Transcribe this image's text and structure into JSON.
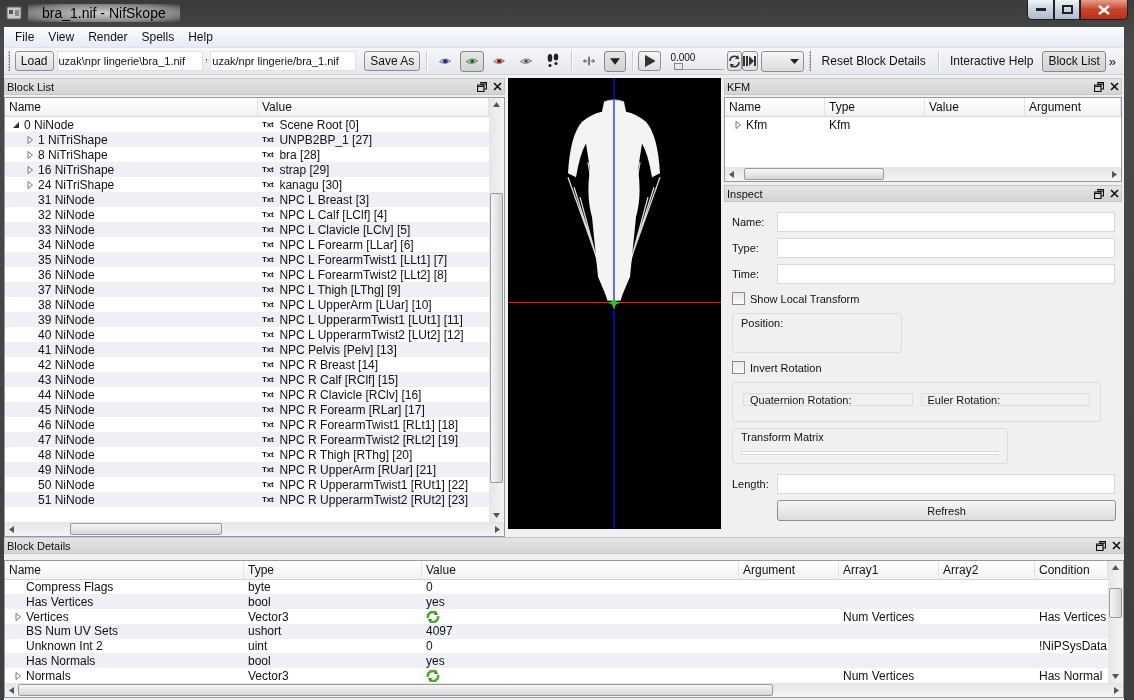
{
  "window": {
    "title": "bra_1.nif - NifSkope"
  },
  "menu": [
    "File",
    "View",
    "Render",
    "Spells",
    "Help"
  ],
  "toolbar": {
    "load_label": "Load",
    "path_in": "uzak\\npr lingerie\\bra_1.nif",
    "path_out": "uzak/npr lingerie/bra_1.nif",
    "save_label": "Save As",
    "view_tools": [
      {
        "kind": "eye",
        "color": "#2b3fc4",
        "selected": false
      },
      {
        "kind": "eye",
        "color": "#3a9f3e",
        "selected": true
      },
      {
        "kind": "eye",
        "color": "#c42020",
        "selected": false
      },
      {
        "kind": "eye",
        "color": "#8c8c8c",
        "selected": false
      },
      {
        "kind": "footprints",
        "selected": false
      },
      {
        "kind": "move",
        "selected": false
      },
      {
        "kind": "dropdown",
        "selected": true
      }
    ],
    "time": {
      "reading": "0.000",
      "level": 0
    },
    "actions": [
      {
        "label": "Reset Block Details",
        "selected": false
      },
      {
        "label": "Interactive Help",
        "selected": false
      },
      {
        "label": "Block List",
        "selected": true
      }
    ],
    "overflow": "»"
  },
  "block_list": {
    "title": "Block List",
    "columns": [
      "Name",
      "Value"
    ],
    "rows": [
      {
        "name": "0 NiNode",
        "tag": "Txt",
        "value": "Scene Root [0]",
        "has_children": true,
        "expanded": true,
        "children": [
          {
            "name": "1 NiTriShape",
            "tag": "Txt",
            "value": "UNPB2BP_1 [27]",
            "has_children": true,
            "expanded": false
          },
          {
            "name": "8 NiTriShape",
            "tag": "Txt",
            "value": "bra [28]",
            "has_children": true,
            "expanded": false
          },
          {
            "name": "16 NiTriShape",
            "tag": "Txt",
            "value": "strap [29]",
            "has_children": true,
            "expanded": false
          },
          {
            "name": "24 NiTriShape",
            "tag": "Txt",
            "value": "kanagu [30]",
            "has_children": true,
            "expanded": false
          },
          {
            "name": "31 NiNode",
            "tag": "Txt",
            "value": "NPC L Breast [3]",
            "has_children": false,
            "expanded": false
          },
          {
            "name": "32 NiNode",
            "tag": "Txt",
            "value": "NPC L Calf [LClf] [4]",
            "has_children": false,
            "expanded": false
          },
          {
            "name": "33 NiNode",
            "tag": "Txt",
            "value": "NPC L Clavicle [LClv] [5]",
            "has_children": false,
            "expanded": false
          },
          {
            "name": "34 NiNode",
            "tag": "Txt",
            "value": "NPC L Forearm [LLar] [6]",
            "has_children": false,
            "expanded": false
          },
          {
            "name": "35 NiNode",
            "tag": "Txt",
            "value": "NPC L ForearmTwist1 [LLt1] [7]",
            "has_children": false,
            "expanded": false
          },
          {
            "name": "36 NiNode",
            "tag": "Txt",
            "value": "NPC L ForearmTwist2 [LLt2] [8]",
            "has_children": false,
            "expanded": false
          },
          {
            "name": "37 NiNode",
            "tag": "Txt",
            "value": "NPC L Thigh [LThg] [9]",
            "has_children": false,
            "expanded": false
          },
          {
            "name": "38 NiNode",
            "tag": "Txt",
            "value": "NPC L UpperArm [LUar] [10]",
            "has_children": false,
            "expanded": false
          },
          {
            "name": "39 NiNode",
            "tag": "Txt",
            "value": "NPC L UpperarmTwist1 [LUt1] [11]",
            "has_children": false,
            "expanded": false
          },
          {
            "name": "40 NiNode",
            "tag": "Txt",
            "value": "NPC L UpperarmTwist2 [LUt2] [12]",
            "has_children": false,
            "expanded": false
          },
          {
            "name": "41 NiNode",
            "tag": "Txt",
            "value": "NPC Pelvis [Pelv] [13]",
            "has_children": false,
            "expanded": false
          },
          {
            "name": "42 NiNode",
            "tag": "Txt",
            "value": "NPC R Breast [14]",
            "has_children": false,
            "expanded": false
          },
          {
            "name": "43 NiNode",
            "tag": "Txt",
            "value": "NPC R Calf [RClf] [15]",
            "has_children": false,
            "expanded": false
          },
          {
            "name": "44 NiNode",
            "tag": "Txt",
            "value": "NPC R Clavicle [RClv] [16]",
            "has_children": false,
            "expanded": false
          },
          {
            "name": "45 NiNode",
            "tag": "Txt",
            "value": "NPC R Forearm [RLar] [17]",
            "has_children": false,
            "expanded": false
          },
          {
            "name": "46 NiNode",
            "tag": "Txt",
            "value": "NPC R ForearmTwist1 [RLt1] [18]",
            "has_children": false,
            "expanded": false
          },
          {
            "name": "47 NiNode",
            "tag": "Txt",
            "value": "NPC R ForearmTwist2 [RLt2] [19]",
            "has_children": false,
            "expanded": false
          },
          {
            "name": "48 NiNode",
            "tag": "Txt",
            "value": "NPC R Thigh [RThg] [20]",
            "has_children": false,
            "expanded": false
          },
          {
            "name": "49 NiNode",
            "tag": "Txt",
            "value": "NPC R UpperArm [RUar] [21]",
            "has_children": false,
            "expanded": false
          },
          {
            "name": "50 NiNode",
            "tag": "Txt",
            "value": "NPC R UpperarmTwist1 [RUt1] [22]",
            "has_children": false,
            "expanded": false
          },
          {
            "name": "51 NiNode",
            "tag": "Txt",
            "value": "NPC R UpperarmTwist2 [RUt2] [23]",
            "has_children": false,
            "expanded": false
          }
        ]
      }
    ]
  },
  "kfm": {
    "title": "KFM",
    "columns": [
      "Name",
      "Type",
      "Value",
      "Argument"
    ],
    "rows": [
      {
        "name": "Kfm",
        "type": "Kfm",
        "expanded": false
      }
    ]
  },
  "inspect": {
    "title": "Inspect",
    "fields": [
      {
        "label": "Name:"
      },
      {
        "label": "Type:"
      },
      {
        "label": "Time:"
      }
    ],
    "show_local_transform": {
      "label": "Show Local Transform",
      "checked": false
    },
    "position": "Position:",
    "invert_rotation": {
      "label": "Invert Rotation",
      "checked": false
    },
    "quaternion": "Quaternion Rotation:",
    "euler": "Euler Rotation:",
    "matrix": "Transform Matrix",
    "length": "Length:",
    "refresh": "Refresh"
  },
  "block_details": {
    "title": "Block Details",
    "columns": [
      "Name",
      "Type",
      "Value",
      "Argument",
      "Array1",
      "Array2",
      "Condition"
    ],
    "rows": [
      {
        "kind": "scalar",
        "name": "Compress Flags",
        "type": "byte",
        "value": "0"
      },
      {
        "kind": "scalar",
        "name": "Has Vertices",
        "type": "bool",
        "value": "yes"
      },
      {
        "kind": "array",
        "name": "Vertices",
        "type": "Vector3",
        "array1": "Num Vertices",
        "condition": "Has Vertices"
      },
      {
        "kind": "scalar",
        "name": "BS Num UV Sets",
        "type": "ushort",
        "value": "4097"
      },
      {
        "kind": "scalar",
        "name": "Unknown Int 2",
        "type": "uint",
        "value": "0",
        "condition": "!NiPSysData"
      },
      {
        "kind": "scalar",
        "name": "Has Normals",
        "type": "bool",
        "value": "yes"
      },
      {
        "kind": "array",
        "name": "Normals",
        "type": "Vector3",
        "array1": "Num Vertices",
        "condition": "Has Normal"
      }
    ]
  }
}
